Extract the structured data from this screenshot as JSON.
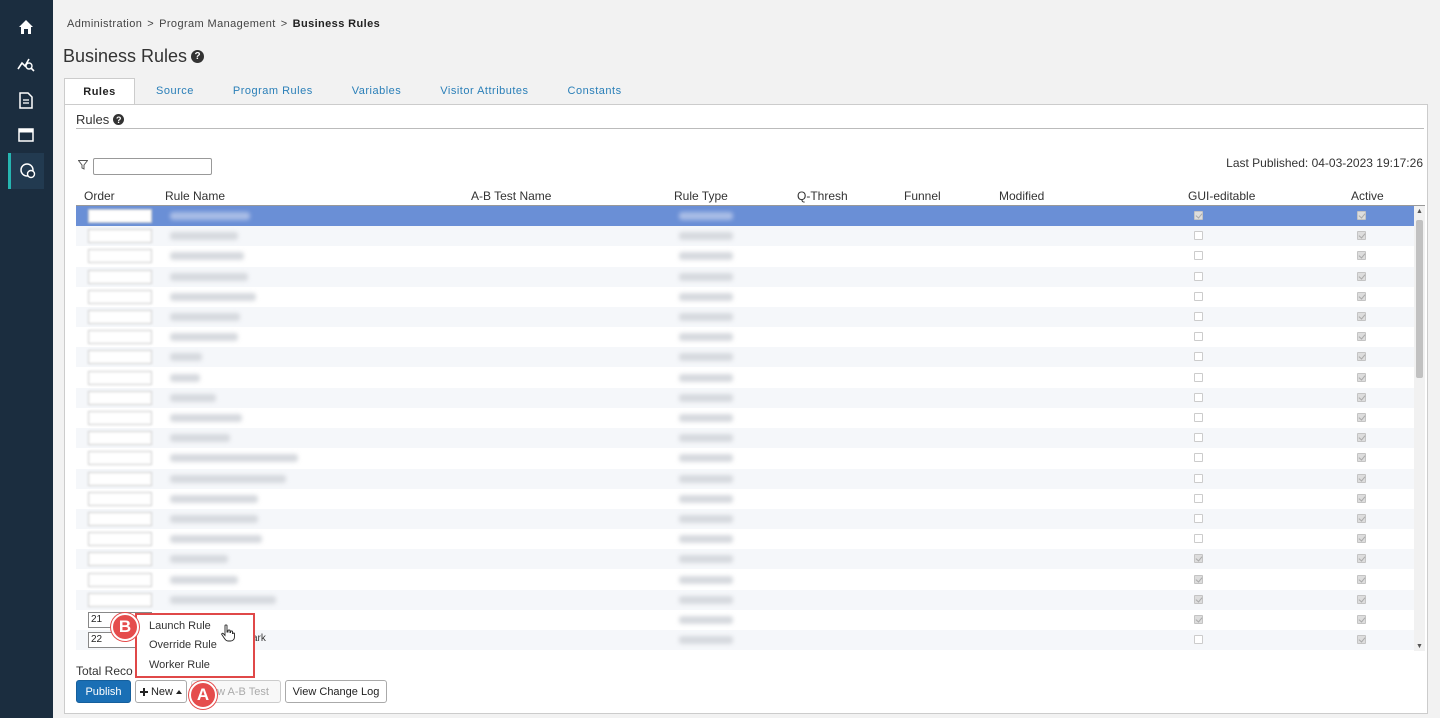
{
  "breadcrumb": {
    "item1": "Administration",
    "item2": "Program Management",
    "current": "Business Rules",
    "separator": ">"
  },
  "page_title": "Business Rules",
  "help_glyph": "?",
  "tabs": [
    "Rules",
    "Source",
    "Program Rules",
    "Variables",
    "Visitor Attributes",
    "Constants"
  ],
  "panel": {
    "title": "Rules",
    "last_published_label": "Last Published:",
    "last_published_value": "04-03-2023 19:17:26"
  },
  "table": {
    "columns": [
      "Order",
      "Rule Name",
      "A-B Test Name",
      "Rule Type",
      "Q-Thresh",
      "Funnel",
      "Modified",
      "GUI-editable",
      "Active"
    ],
    "visible_order_values": [
      "21",
      "22"
    ],
    "partial_rule_name_text": "ark",
    "row_count_visible": 22
  },
  "footer": {
    "total_records_label": "Total Reco",
    "publish_label": "Publish",
    "new_label": "New",
    "new_ab_test_label": "New A-B Test",
    "view_change_log_label": "View Change Log"
  },
  "new_dropdown": {
    "items": [
      "Launch Rule",
      "Override Rule",
      "Worker Rule"
    ]
  },
  "annotations": {
    "marker_a": "A",
    "marker_b": "B"
  },
  "colors": {
    "sidebar": "#1b2d3f",
    "accent": "#26b5b1",
    "link": "#2a7fb8",
    "primary": "#1a6fb5",
    "highlight": "#e04848",
    "selected_row": "#6a8fd6"
  },
  "icons": [
    "home-icon",
    "analytics-icon",
    "document-icon",
    "browser-icon",
    "rules-icon",
    "filter-icon",
    "help-icon",
    "plus-icon",
    "caret-up-icon",
    "hand-cursor-icon"
  ]
}
